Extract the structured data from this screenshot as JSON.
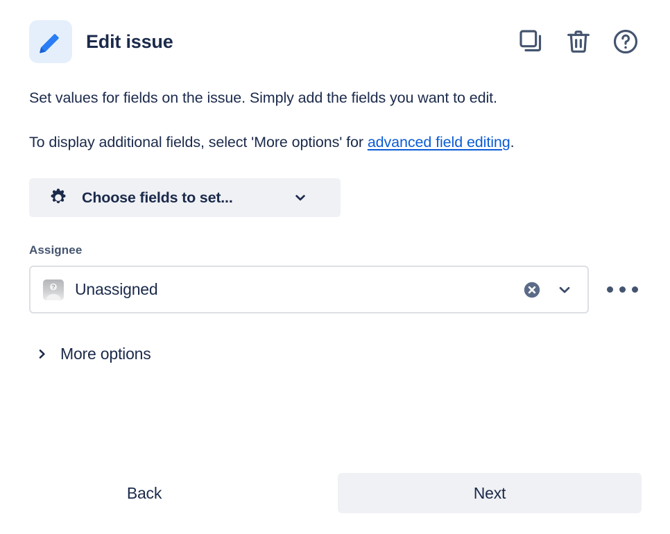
{
  "header": {
    "title": "Edit issue",
    "icon": "pencil-icon",
    "actions": [
      {
        "name": "duplicate-icon",
        "label": "Duplicate"
      },
      {
        "name": "delete-icon",
        "label": "Delete"
      },
      {
        "name": "help-icon",
        "label": "Help"
      }
    ]
  },
  "body": {
    "paragraph_1": "Set values for fields on the issue. Simply add the fields you want to edit.",
    "paragraph_2_prefix": "To display additional fields, select 'More options' for ",
    "paragraph_2_link": "advanced field editing",
    "paragraph_2_suffix": "."
  },
  "choose_fields": {
    "label": "Choose fields to set...",
    "icon": "gear-icon",
    "caret": "chevron-down-icon"
  },
  "assignee": {
    "label": "Assignee",
    "value": "Unassigned",
    "avatar": "unassigned-avatar-icon",
    "clear_icon": "clear-circle-icon",
    "caret": "chevron-down-icon",
    "overflow_icon": "more-options-dots-icon"
  },
  "more_options": {
    "label": "More options",
    "icon": "chevron-right-icon",
    "expanded": false
  },
  "footer": {
    "back_label": "Back",
    "next_label": "Next"
  },
  "colors": {
    "title_text": "#1B2A4B",
    "link": "#0B5CD5",
    "accent_blue": "#2A7DF4",
    "tile_bg": "#E5EFFC",
    "button_bg": "#F0F1F4",
    "field_border": "#DCDFE4",
    "label_text": "#44546F",
    "icon_gray": "#44546F"
  }
}
